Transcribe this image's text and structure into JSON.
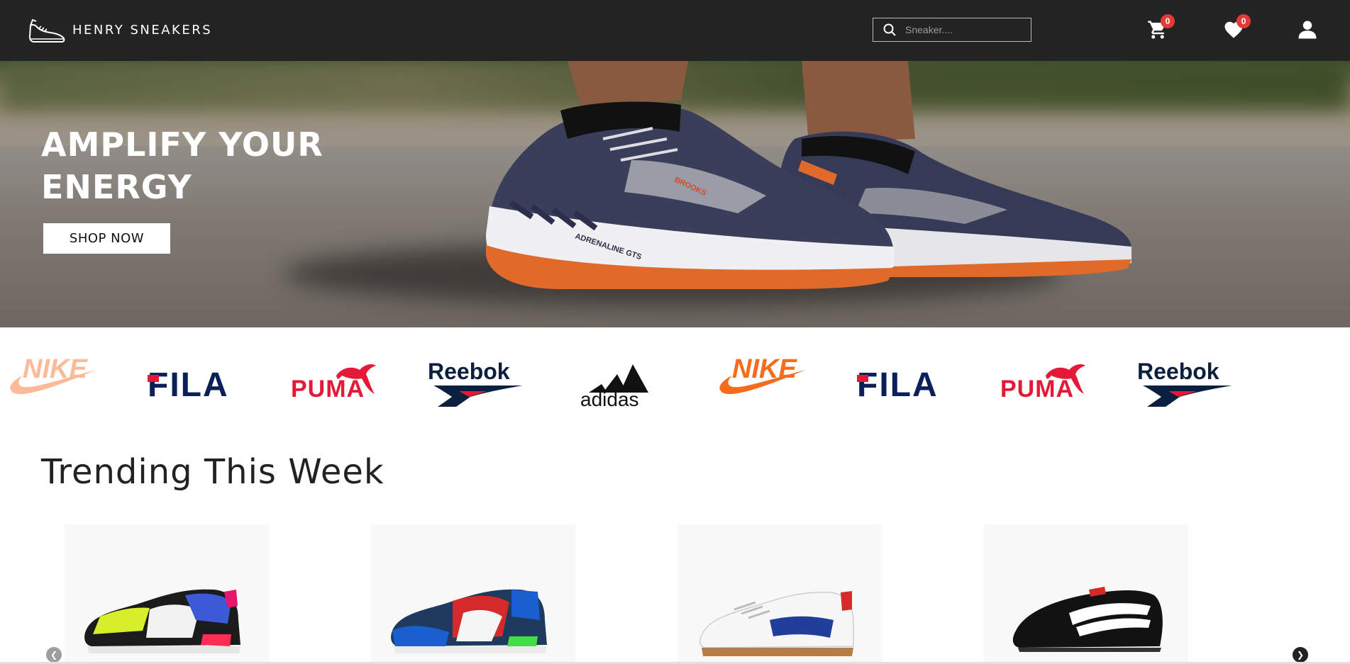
{
  "nav": {
    "logo_text": "HENRY SNEAKERS",
    "search_placeholder": "Sneaker....",
    "cart_count": "0",
    "wishlist_count": "0",
    "icons": [
      "shoe-logo-icon",
      "search-icon",
      "cart-icon",
      "heart-icon",
      "user-icon"
    ]
  },
  "hero": {
    "title": "AMPLIFY YOUR ENERGY",
    "button_label": "SHOP NOW"
  },
  "brands": {
    "items": [
      "NIKE",
      "FILA",
      "PUMA",
      "Reebok",
      "adidas",
      "NIKE",
      "FILA",
      "PUMA",
      "Reebok"
    ]
  },
  "trending": {
    "title": "Trending This Week"
  },
  "colors": {
    "nav_bg": "#232323",
    "badge": "#e53935",
    "nike_orange": "#f76b1c",
    "fila_navy": "#0b2058",
    "fila_red": "#e31937",
    "puma_red": "#e31937",
    "reebok_navy": "#0b1f3f"
  }
}
